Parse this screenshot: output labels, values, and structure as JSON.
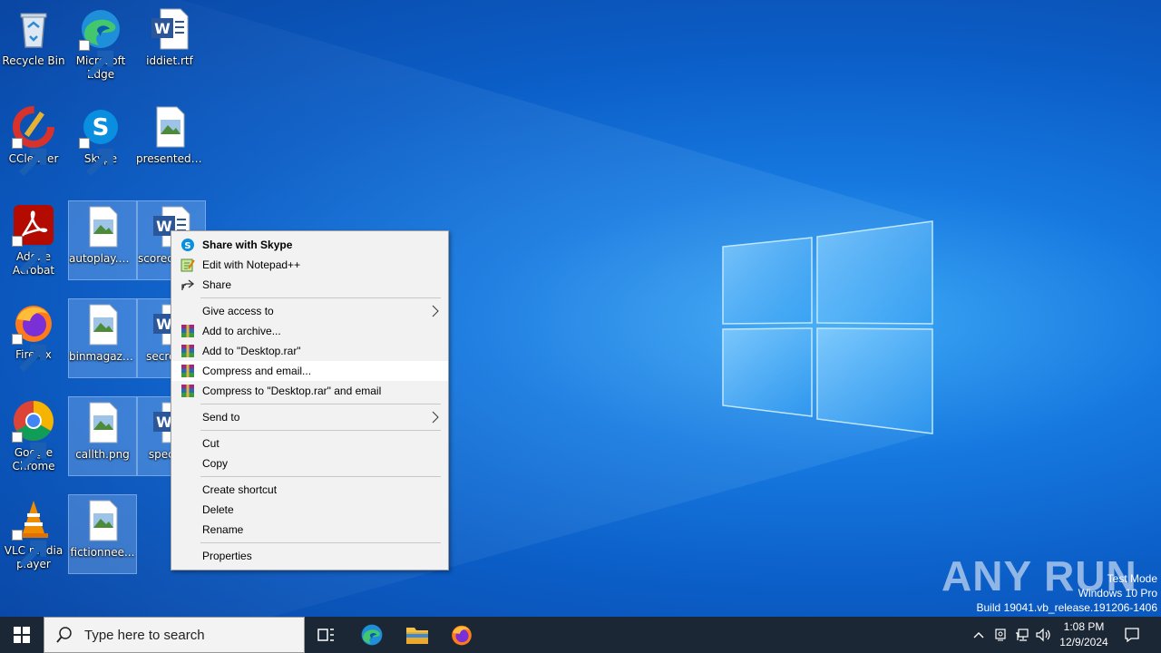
{
  "desktop": {
    "icons": [
      {
        "label": "Recycle Bin",
        "icon": "recycle-bin-icon"
      },
      {
        "label": "Microsoft Edge",
        "icon": "edge-icon"
      },
      {
        "label": "iddiet.rtf",
        "icon": "word-document-icon"
      },
      {
        "label": "CCleaner",
        "icon": "ccleaner-icon"
      },
      {
        "label": "Skype",
        "icon": "skype-icon"
      },
      {
        "label": "presentedd...",
        "icon": "image-file-icon"
      },
      {
        "label": "Adobe Acrobat",
        "icon": "acrobat-icon"
      },
      {
        "label": "autoplay.png",
        "icon": "image-file-icon"
      },
      {
        "label": "scorec...y.r...",
        "icon": "word-document-icon"
      },
      {
        "label": "Firefox",
        "icon": "firefox-icon"
      },
      {
        "label": "binmagazin...",
        "icon": "image-file-icon"
      },
      {
        "label": "secreta...",
        "icon": "word-document-icon"
      },
      {
        "label": "Google Chrome",
        "icon": "chrome-icon"
      },
      {
        "label": "callth.png",
        "icon": "image-file-icon"
      },
      {
        "label": "specifi...",
        "icon": "word-document-icon"
      },
      {
        "label": "VLC media player",
        "icon": "vlc-icon"
      },
      {
        "label": "fictionnee...",
        "icon": "image-file-icon"
      }
    ]
  },
  "context_menu": {
    "items": [
      {
        "label": "Share with Skype",
        "icon": "skype-icon"
      },
      {
        "label": "Edit with Notepad++",
        "icon": "notepadpp-icon"
      },
      {
        "label": "Share",
        "icon": "share-icon"
      },
      {
        "label": "Give access to"
      },
      {
        "label": "Add to archive...",
        "icon": "winrar-icon"
      },
      {
        "label": "Add to \"Desktop.rar\"",
        "icon": "winrar-icon"
      },
      {
        "label": "Compress and email...",
        "icon": "winrar-icon"
      },
      {
        "label": "Compress to \"Desktop.rar\" and email",
        "icon": "winrar-icon"
      },
      {
        "label": "Send to"
      },
      {
        "label": "Cut"
      },
      {
        "label": "Copy"
      },
      {
        "label": "Create shortcut"
      },
      {
        "label": "Delete"
      },
      {
        "label": "Rename"
      },
      {
        "label": "Properties"
      }
    ],
    "highlighted": "Compress and email..."
  },
  "watermark": {
    "brand": "ANY RUN",
    "line1": "Test Mode",
    "line2": "Windows 10 Pro",
    "line3": "Build 19041.vb_release.191206-1406"
  },
  "taskbar": {
    "search_placeholder": "Type here to search",
    "time": "1:08 PM",
    "date": "12/9/2024"
  },
  "colors": {
    "wallpaper_accent": "#1679e0",
    "taskbar": "#1c2735",
    "menu_bg": "#f2f2f2"
  }
}
